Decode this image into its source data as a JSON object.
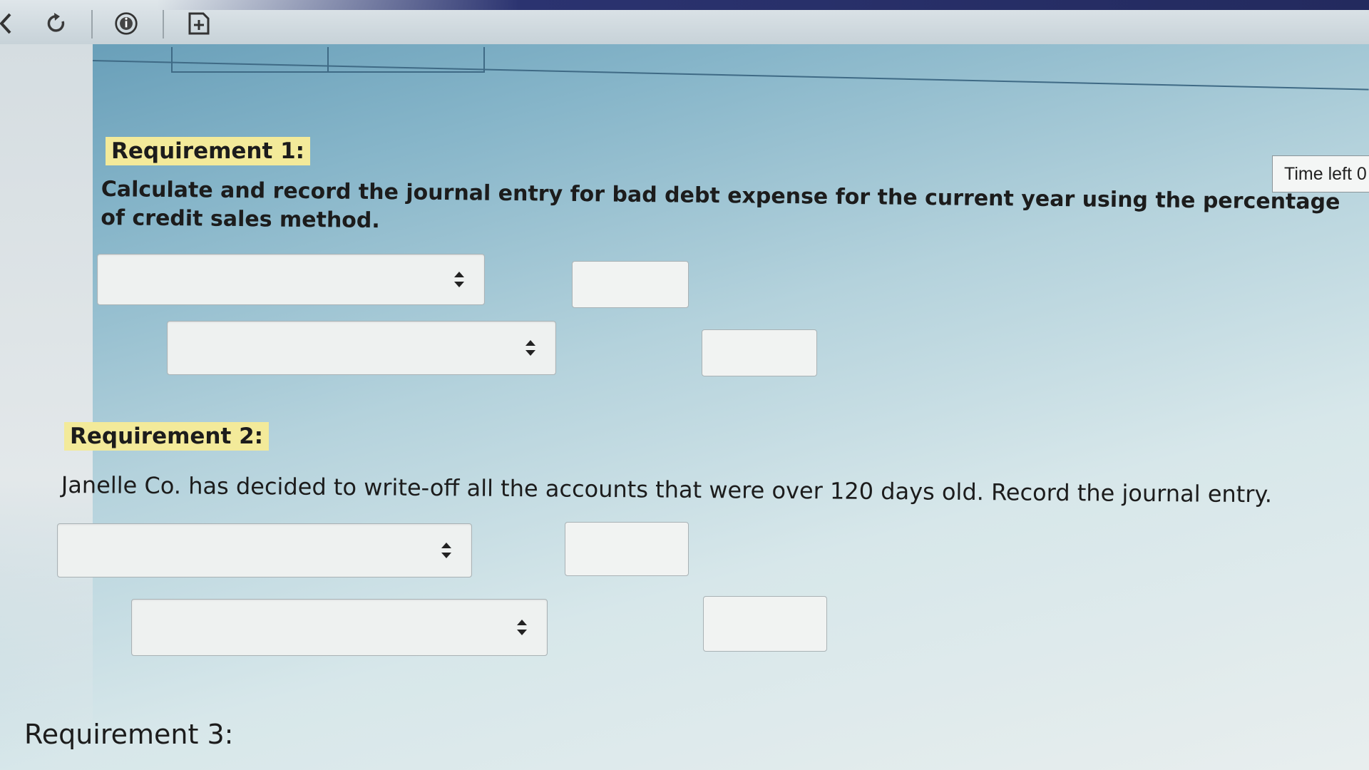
{
  "toolbar": {
    "icons": [
      "back-chevron-icon",
      "refresh-icon",
      "info-icon",
      "add-note-icon"
    ]
  },
  "timer": {
    "label": "Time left 0"
  },
  "requirements": [
    {
      "label": "Requirement 1:",
      "instruction": "Calculate and record the journal entry for bad debt expense for the current year using the percentage of credit sales method.",
      "entries": [
        {
          "account": "",
          "amount": ""
        },
        {
          "account": "",
          "amount": ""
        }
      ]
    },
    {
      "label": "Requirement 2:",
      "instruction": "Janelle Co. has decided to write-off all the accounts that were over 120 days old. Record the journal entry.",
      "entries": [
        {
          "account": "",
          "amount": ""
        },
        {
          "account": "",
          "amount": ""
        }
      ]
    },
    {
      "label": "Requirement 3:"
    }
  ]
}
